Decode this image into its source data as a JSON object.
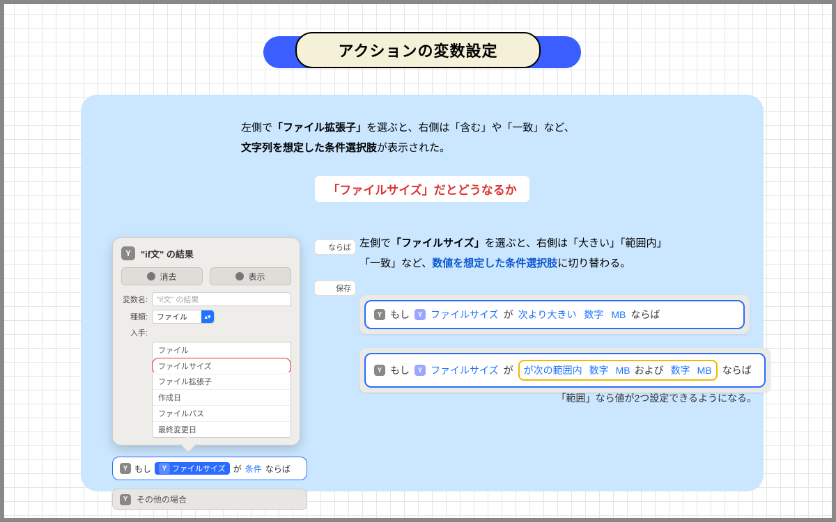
{
  "title": "アクションの変数設定",
  "intro_pre": "左側で",
  "intro_b1": "「ファイル拡張子」",
  "intro_mid": "を選ぶと、右側は「含む」や「一致」など、",
  "intro_b2": "文字列を想定した条件選択肢",
  "intro_post": "が表示された。",
  "subheading": "「ファイルサイズ」だとどうなるか",
  "desc2_pre": "左側で",
  "desc2_b1": "「ファイルサイズ」",
  "desc2_mid": "を選ぶと、右側は「大きい」「範囲内」",
  "desc2_line2a": "「一致」など、",
  "desc2_b2": "数値を想定した条件選択肢",
  "desc2_line2b": "に切り替わる。",
  "peek1": "ならば",
  "peek2": "保存",
  "pop_title": "\"if文\" の結果",
  "btn_clear": "消去",
  "btn_show": "表示",
  "lab_varname": "変数名:",
  "varname_placeholder": "\"if文\" の結果",
  "lab_kind": "種類:",
  "kind_value": "ファイル",
  "lab_source": "入手:",
  "droplist": {
    "i0": "ファイル",
    "i1": "ファイルサイズ",
    "i2": "ファイル拡張子",
    "i3": "作成日",
    "i4": "ファイルパス",
    "i5": "最終変更日"
  },
  "cond_moshi": "もし",
  "cond_token_filesize": "ファイルサイズ",
  "cond_ga": "が",
  "cond_cond": "条件",
  "cond_naraba": "ならば",
  "otherwise": "その他の場合",
  "ex_moshi": "もし",
  "ex_filesize": "ファイルサイズ",
  "ex_ga": "が",
  "ex1_op": "次より大きい",
  "ex_num": "数字",
  "ex_mb": "MB",
  "ex_naraba": "ならば",
  "ex2_op": "が次の範囲内",
  "ex_oyobi": "および",
  "caption": "「範囲」なら値が2つ設定できるようになる。"
}
